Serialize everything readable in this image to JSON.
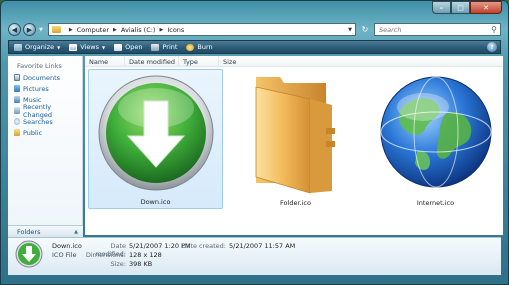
{
  "window": {
    "caption_min": "–",
    "caption_max": "□",
    "caption_close": "✕"
  },
  "address": {
    "back_glyph": "◀",
    "forward_glyph": "▶",
    "crumbs": [
      "Computer",
      "Avialis (C:)",
      "Icons"
    ],
    "refresh_glyph": "↻",
    "search_placeholder": "Search",
    "search_icon": "magnifier-icon"
  },
  "toolbar": {
    "organize": "Organize",
    "views": "Views",
    "open": "Open",
    "print": "Print",
    "burn": "Burn",
    "help": "?"
  },
  "sidebar": {
    "heading": "Favorite Links",
    "items": [
      {
        "label": "Documents",
        "icon": "documents-icon"
      },
      {
        "label": "Pictures",
        "icon": "pictures-icon"
      },
      {
        "label": "Music",
        "icon": "music-icon"
      },
      {
        "label": "Recently Changed",
        "icon": "recently-changed-icon"
      },
      {
        "label": "Searches",
        "icon": "searches-icon"
      },
      {
        "label": "Public",
        "icon": "public-icon"
      }
    ],
    "folders_label": "Folders"
  },
  "columns": [
    "Name",
    "Date modified",
    "Type",
    "Size"
  ],
  "files": [
    {
      "name": "Down.ico",
      "icon": "down-arrow-icon",
      "selected": true
    },
    {
      "name": "Folder.ico",
      "icon": "folder-icon",
      "selected": false
    },
    {
      "name": "Internet.ico",
      "icon": "globe-icon",
      "selected": false
    }
  ],
  "details": {
    "name": "Down.ico",
    "type": "ICO File",
    "date_modified_label": "Date modified:",
    "date_modified": "5/21/2007 1:20 PM",
    "dimensions_label": "Dimensions:",
    "dimensions": "128 x 128",
    "size_label": "Size:",
    "size": "398 KB",
    "date_created_label": "Date created:",
    "date_created": "5/21/2007 11:57 AM"
  },
  "colors": {
    "accent_green": "#3fae3a",
    "folder_orange": "#e9a53b",
    "globe_blue": "#1d5fc4",
    "link_blue": "#1a5d9a"
  }
}
